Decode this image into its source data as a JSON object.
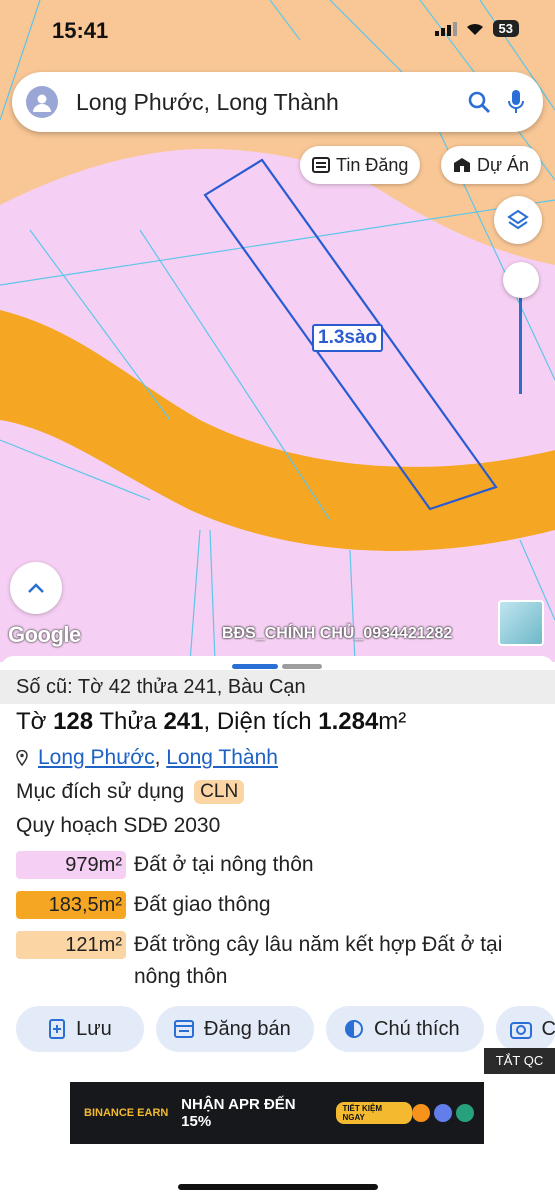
{
  "status": {
    "time": "15:41",
    "battery": "53"
  },
  "search": {
    "text": "Long Phước, Long Thành"
  },
  "map": {
    "tin_dang_label": "Tin Đăng",
    "du_an_label": "Dự Án",
    "plot_area_label": "1.3sào",
    "google_label": "Google",
    "watermark": "BĐS_CHÍNH CHỦ_0934421282"
  },
  "sheet": {
    "old_info": "Số cũ: Tờ 42 thửa 241, Bàu Cạn",
    "parcel": {
      "to_label": "Tờ",
      "to_value": "128",
      "thua_label": "Thửa",
      "thua_value": "241",
      "area_label": "Diện tích",
      "area_value": "1.284",
      "area_unit": "m²"
    },
    "location": {
      "commune": "Long Phước",
      "district": "Long Thành"
    },
    "purpose_label": "Mục đích sử dụng",
    "purpose_code": "CLN",
    "plan_label": "Quy hoạch SDĐ 2030",
    "zones": [
      {
        "area": "979m²",
        "label": "Đất ở tại nông thôn",
        "color": "#f6d0f4"
      },
      {
        "area": "183,5m²",
        "label": "Đất giao thông",
        "color": "#f5a623"
      },
      {
        "area": "121m²",
        "label": "Đất trồng cây lâu năm kết hợp Đất ở tại nông thôn",
        "color": "#fbd5a4"
      }
    ],
    "actions": [
      {
        "label": "Lưu",
        "icon": "bookmark-plus-icon"
      },
      {
        "label": "Đăng bán",
        "icon": "listing-icon"
      },
      {
        "label": "Chú thích",
        "icon": "legend-icon"
      },
      {
        "label": "C",
        "icon": "camera-icon"
      }
    ],
    "close_ad_label": "TẮT QC"
  },
  "ad": {
    "brand": "BINANCE EARN",
    "title": "NHẬN APR ĐẾN 15%",
    "cta": "TIẾT KIỆM NGAY"
  }
}
